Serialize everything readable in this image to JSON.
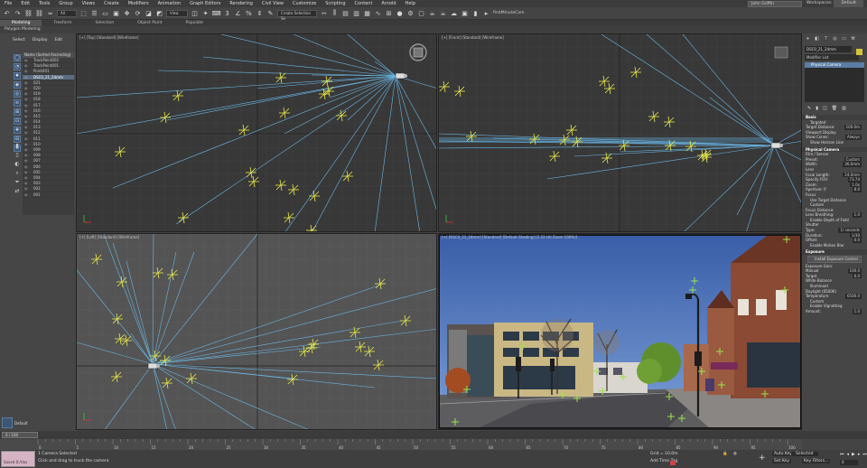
{
  "menu": [
    "File",
    "Edit",
    "Tools",
    "Group",
    "Views",
    "Create",
    "Modifiers",
    "Animation",
    "Graph Editors",
    "Rendering",
    "Civil View",
    "Customize",
    "Scripting",
    "Content",
    "Arnold",
    "Help"
  ],
  "account": {
    "user": "John Griffin",
    "workspaces_label": "Workspaces:",
    "workspace": "Default"
  },
  "toolbar": {
    "filter_select": "All",
    "view_select": "View",
    "selection_set": "Create Selection Se",
    "script_name": "firstMinuteCam"
  },
  "ribbon": {
    "tabs": [
      "Modeling",
      "Freeform",
      "Selection",
      "Object Paint",
      "Populate"
    ],
    "active": "Modeling",
    "subtitle": "Polygon Modeling"
  },
  "scene_explorer": {
    "tabs": [
      "Select",
      "Display",
      "Edit"
    ],
    "header": "Name (Sorted Ascending)",
    "rows": [
      "TrackPoint002",
      "TrackPoint001",
      "Point001",
      "DSC0_21_24mm",
      "021",
      "020",
      "019",
      "018",
      "017",
      "016",
      "015",
      "014",
      "013",
      "012",
      "011",
      "010",
      "009",
      "008",
      "007",
      "006",
      "005",
      "004",
      "003",
      "002",
      "001"
    ],
    "selected_index": 3
  },
  "viewports": {
    "top": "[+] [Top] [Standard] [Wireframe]",
    "front": "[+] [Front] [Standard] [Wireframe]",
    "left": "[+] [Left] [Standard] [Wireframe]",
    "camera": "[+] [DSC0_21_24mm] [Standard] [Default Shading] [2.22 (Hi Zoom 100%)]"
  },
  "command_panel": {
    "object_name": "DSC0_21_24mm",
    "modifier_list": "Modifier List",
    "stack_item": "Physical Camera",
    "basic": {
      "title": "Basic",
      "targeted": "Targeted",
      "target_distance_label": "Target Distance:",
      "target_distance": "100.0m",
      "viewport_display": "Viewport Display",
      "show_cones_label": "Show Cones:",
      "show_cones": "Always",
      "show_horizon": "Show Horizon Line"
    },
    "physical": {
      "title": "Physical Camera",
      "film_sensor": "Film / Sensor",
      "preset_label": "Preset:",
      "preset": "Custom",
      "width_label": "Width:",
      "width": "36.0mm",
      "lens": "Lens",
      "focal_label": "Focal Length:",
      "focal": "24.0mm",
      "specify_fov": "Specify FOV:",
      "fov": "73.74",
      "zoom_label": "Zoom:",
      "zoom": "1.0x",
      "aperture_label": "Aperture: f/",
      "aperture": "8.0",
      "focus": "Focus",
      "use_target": "Use Target Distance",
      "custom": "Custom",
      "focus_distance_label": "Focus Distance:",
      "lens_breathing_label": "Lens Breathing:",
      "lens_breathing": "1.0",
      "dof": "Enable Depth of Field",
      "shutter": "Shutter",
      "type_label": "Type:",
      "type": "1/ seconds",
      "duration_label": "Duration:",
      "duration": "1/30",
      "offset_label": "Offset:",
      "offset": "0.0",
      "motion_blur": "Enable Motion Blur"
    },
    "exposure": {
      "title": "Exposure",
      "install_button": "Install Exposure Control",
      "exposure_gain": "Exposure Gain:",
      "manual": "Manual",
      "manual_val": "100.0",
      "target": "Target",
      "target_val": "6.0",
      "white_balance": "White Balance",
      "illuminant": "Illuminant",
      "illuminant_val": "Daylight (6500K)",
      "temperature": "Temperature",
      "temperature_val": "6500.0",
      "custom": "Custom",
      "vignetting": "Enable Vignetting",
      "amount_label": "Amount:",
      "amount": "1.0"
    }
  },
  "timeline": {
    "slider": "0 / 100",
    "ticks": [
      "0",
      "5",
      "10",
      "15",
      "20",
      "25",
      "30",
      "35",
      "40",
      "45",
      "50",
      "55",
      "60",
      "65",
      "70",
      "75",
      "80",
      "85",
      "90",
      "95",
      "100"
    ]
  },
  "status": {
    "maxscript": "Saved 0:/Uos",
    "line1": "1 Camera Selected",
    "line2": "Click and drag to truck the camera",
    "grid": "Grid = 10.0m",
    "add_time_tag": "Add Time Tag",
    "auto_key": "Auto Key",
    "selected": "Selected",
    "set_key": "Set Key",
    "key_filters": "Key Filters...",
    "frame": "0",
    "default_label": "Default"
  }
}
